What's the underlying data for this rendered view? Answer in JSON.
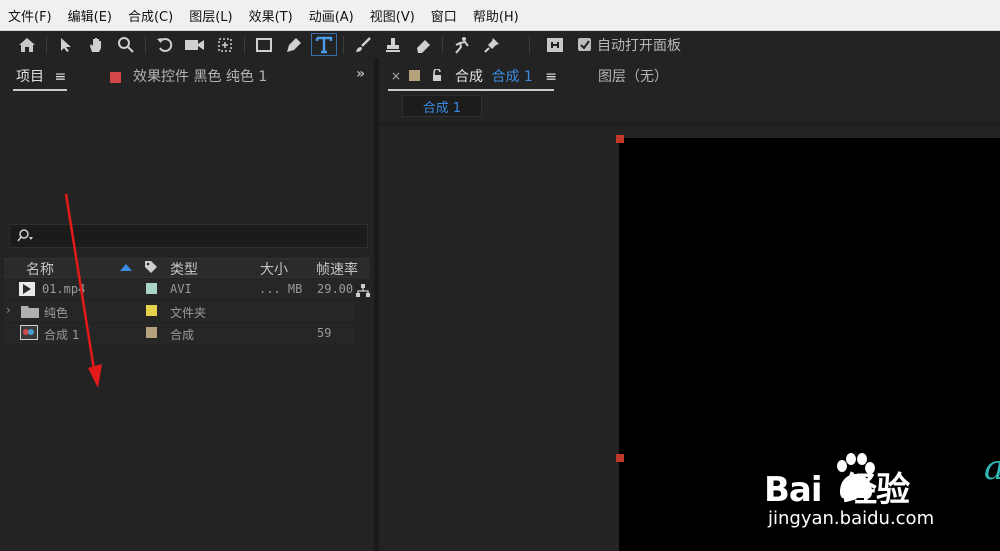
{
  "menu": [
    "文件(F)",
    "编辑(E)",
    "合成(C)",
    "图层(L)",
    "效果(T)",
    "动画(A)",
    "视图(V)",
    "窗口",
    "帮助(H)"
  ],
  "toolbar": {
    "tools": [
      "home-icon",
      "selection-arrow-icon",
      "hand-icon",
      "zoom-icon",
      "rotate-icon",
      "camera-icon",
      "pan-behind-icon",
      "rectangle-icon",
      "pen-icon",
      "type-icon",
      "brush-icon",
      "clone-stamp-icon",
      "eraser-icon",
      "roto-brush-icon",
      "puppet-pin-icon"
    ],
    "auto_open_label": "自动打开面板",
    "auto_open_checked": true
  },
  "project_panel": {
    "tab_label": "项目",
    "effects_tab_label": "效果控件 黑色 纯色 1",
    "expand_symbol": "»",
    "search_icon": "search-icon",
    "columns": [
      "名称",
      "类型",
      "大小",
      "帧速率"
    ],
    "items": [
      {
        "name": "01.mp4",
        "type": "AVI",
        "size": "... MB",
        "fps": "29.00",
        "label_color": "#a9d4c4",
        "icon": "video-icon"
      },
      {
        "name": "纯色",
        "type": "文件夹",
        "size": "",
        "fps": "",
        "label_color": "#e6d14a",
        "icon": "folder-icon"
      },
      {
        "name": "合成 1",
        "type": "合成",
        "size": "",
        "fps": "59",
        "label_color": "#b5a17b",
        "icon": "composition-icon"
      }
    ]
  },
  "comp_panel": {
    "close": "×",
    "prefix": "合成",
    "comp_name": "合成 1",
    "layer_tab": "图层（无）",
    "flow_tab": "合成 1"
  },
  "watermark": {
    "brand": "Bai  经验",
    "url": "jingyan.baidu.com"
  },
  "colors": {
    "accent_blue": "#2d8ceb",
    "handle_red": "#c0392b",
    "annotation_red": "#e31a1a"
  }
}
